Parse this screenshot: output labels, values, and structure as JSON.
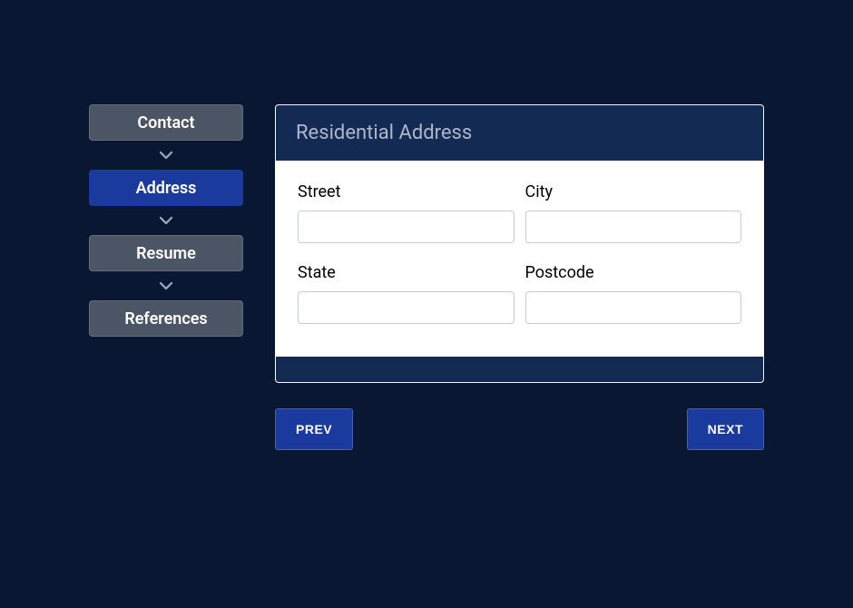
{
  "stepper": {
    "steps": [
      {
        "label": "Contact",
        "active": false
      },
      {
        "label": "Address",
        "active": true
      },
      {
        "label": "Resume",
        "active": false
      },
      {
        "label": "References",
        "active": false
      }
    ]
  },
  "card": {
    "title": "Residential Address"
  },
  "fields": {
    "street": {
      "label": "Street",
      "value": ""
    },
    "city": {
      "label": "City",
      "value": ""
    },
    "state": {
      "label": "State",
      "value": ""
    },
    "postcode": {
      "label": "Postcode",
      "value": ""
    }
  },
  "nav": {
    "prev": "PREV",
    "next": "NEXT"
  }
}
